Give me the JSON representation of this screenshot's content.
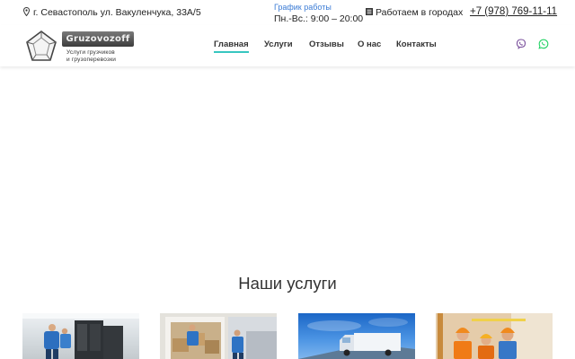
{
  "topbar": {
    "address": "г. Севастополь ул. Вакуленчука, 33А/5",
    "schedule_label": "График работы",
    "schedule_value": "Пн.-Вс.: 9:00 – 20:00",
    "cities": "Работаем в городах",
    "phone": "+7 (978) 769-11-11"
  },
  "logo": {
    "brand": "Gruzovozoff",
    "tagline_line1": "Услуги грузчиков",
    "tagline_line2": "и грузоперевозки"
  },
  "nav": {
    "items": [
      {
        "label": "Главная",
        "active": true
      },
      {
        "label": "Услуги",
        "active": false
      },
      {
        "label": "Отзывы",
        "active": false
      },
      {
        "label": "О нас",
        "active": false
      },
      {
        "label": "Контакты",
        "active": false
      }
    ]
  },
  "social": {
    "viber_color": "#7b519d",
    "whatsapp_color": "#25d366"
  },
  "services": {
    "title": "Наши услуги",
    "cards": [
      {
        "icon": "movers-carrying-appliance-photo"
      },
      {
        "icon": "movers-loading-van-photo"
      },
      {
        "icon": "truck-on-road-photo"
      },
      {
        "icon": "workers-in-hardhats-photo"
      }
    ]
  },
  "colors": {
    "accent": "#37c6c0",
    "link_blue": "#3a7bd5"
  }
}
